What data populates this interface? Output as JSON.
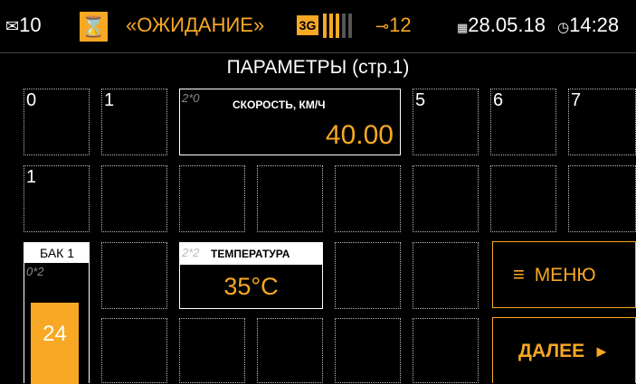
{
  "status": {
    "messages_count": "10",
    "mode_text": "«ОЖИДАНИЕ»",
    "network": "3G",
    "signal_bars_active": 3,
    "signal_bars_total": 5,
    "connections_count": "12",
    "date": "28.05.18",
    "time": "14:28"
  },
  "page_title": "ПАРАМЕТРЫ (стр.1)",
  "grid": {
    "row1_labels": [
      "0",
      "1",
      "5",
      "6",
      "7"
    ],
    "row2_labels": [
      "1"
    ]
  },
  "widgets": {
    "speed": {
      "index": "2*0",
      "label": "СКОРОСТЬ, КМ/Ч",
      "value": "40.00"
    },
    "temperature": {
      "index": "2*2",
      "label": "ТЕМПЕРАТУРА",
      "value": "35°C"
    },
    "tank": {
      "index": "0*2",
      "label": "БАК 1",
      "value": "24"
    }
  },
  "buttons": {
    "menu": "МЕНЮ",
    "next": "ДАЛЕЕ"
  },
  "colors": {
    "accent": "#f7a824",
    "background": "#000000"
  },
  "icons": {
    "messages": "envelope-icon",
    "mode": "hourglass-icon",
    "connections": "plug-icon",
    "date": "calendar-icon",
    "time": "clock-icon",
    "menu": "hamburger-icon",
    "next": "play-triangle-icon"
  }
}
